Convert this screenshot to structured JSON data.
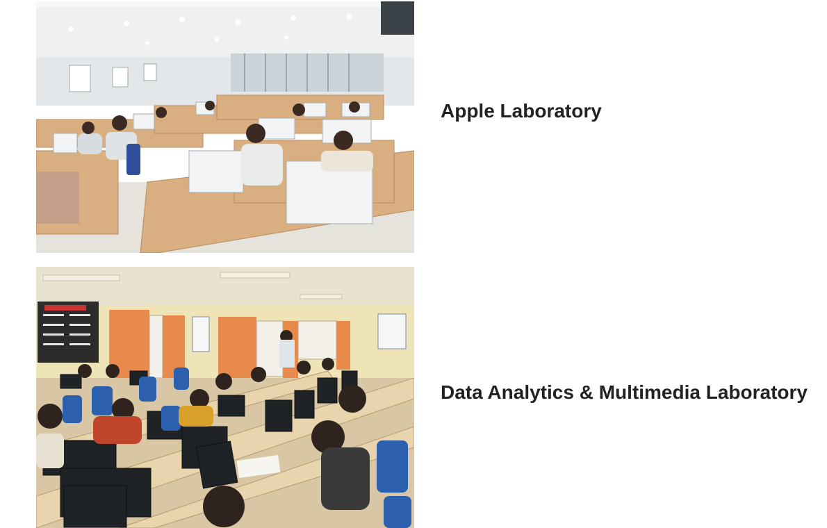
{
  "labs": [
    {
      "title": "Apple Laboratory",
      "image_icon": "photo-apple-lab"
    },
    {
      "title": "Data Analytics & Multimedia Laboratory",
      "image_icon": "photo-data-analytics-lab"
    }
  ],
  "colors": {
    "text": "#222222",
    "background": "#ffffff"
  }
}
